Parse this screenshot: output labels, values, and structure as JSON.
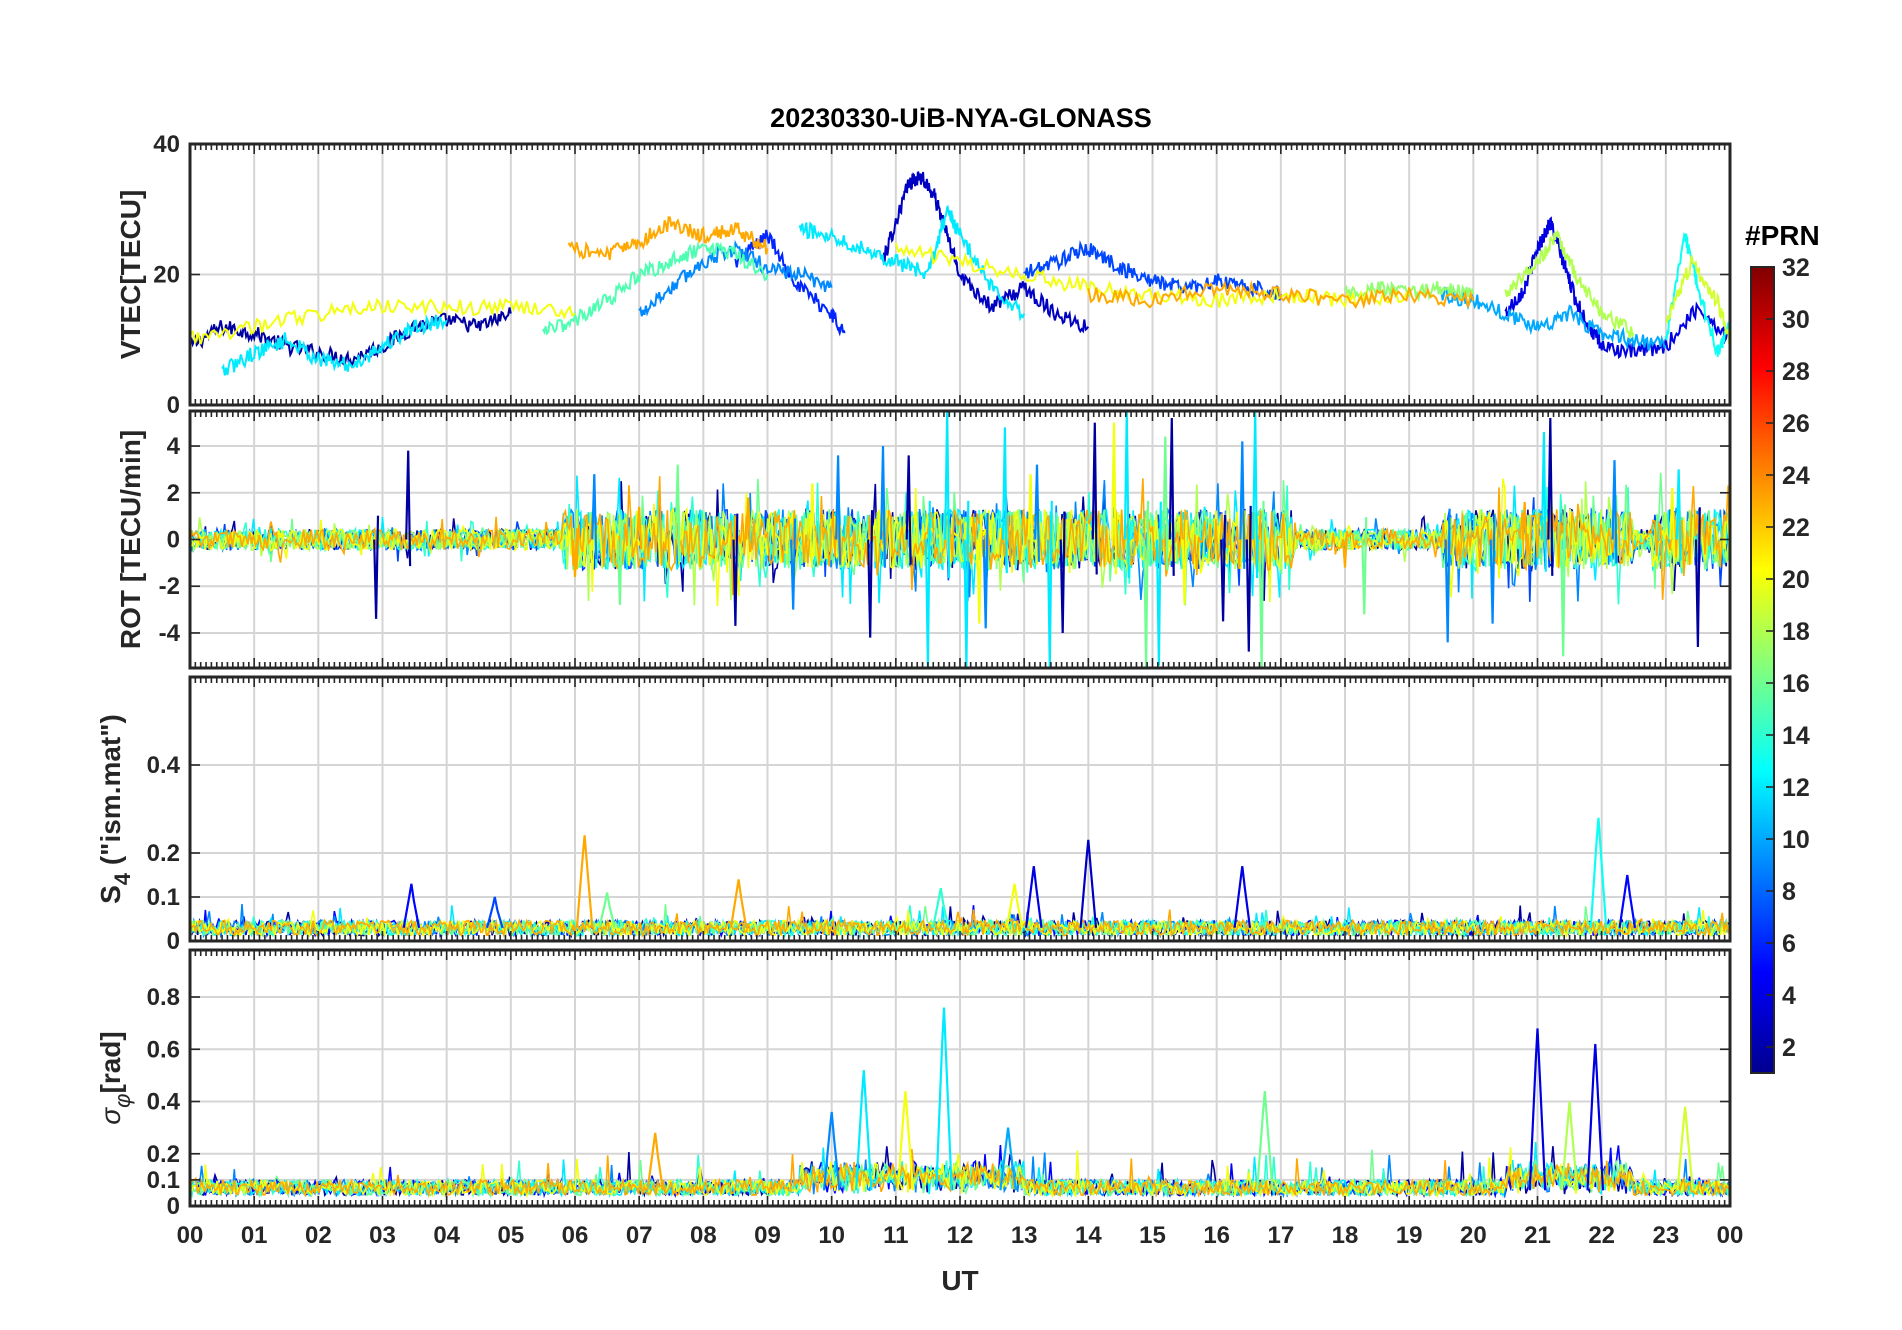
{
  "chart_data": {
    "type": "line",
    "title": "20230330-UiB-NYA-GLONASS",
    "xlabel": "UT",
    "x_ticks": [
      "00",
      "01",
      "02",
      "03",
      "04",
      "05",
      "06",
      "07",
      "08",
      "09",
      "10",
      "11",
      "12",
      "13",
      "14",
      "15",
      "16",
      "17",
      "18",
      "19",
      "20",
      "21",
      "22",
      "23",
      "00"
    ],
    "xlim_hours": [
      0,
      24
    ],
    "grid": true,
    "colorbar": {
      "title": "#PRN",
      "range": [
        1,
        32
      ],
      "ticks": [
        "2",
        "4",
        "6",
        "8",
        "10",
        "12",
        "14",
        "16",
        "18",
        "20",
        "22",
        "24",
        "26",
        "28",
        "30",
        "32"
      ],
      "colormap": "jet",
      "placement": "right"
    },
    "panels": [
      {
        "id": "vtec",
        "ylabel": "VTEC[TECU]",
        "ylim": [
          0,
          40
        ],
        "y_ticks": [
          0,
          20,
          40
        ],
        "y_tick_labels": [
          "0",
          "20",
          "40"
        ],
        "series": [
          {
            "prn": 2,
            "x": [
              0,
              0.5,
              1,
              1.5,
              2,
              2.5,
              3,
              3.5,
              4,
              4.5,
              5
            ],
            "y": [
              9,
              12,
              11,
              9,
              8,
              7,
              9,
              12,
              13,
              12,
              14
            ]
          },
          {
            "prn": 3,
            "x": [
              10.8,
              11,
              11.2,
              11.4,
              11.6,
              11.8,
              12,
              12.5,
              13,
              13.5,
              14
            ],
            "y": [
              22,
              28,
              34,
              35,
              32,
              26,
              20,
              15,
              18,
              14,
              12
            ]
          },
          {
            "prn": 4,
            "x": [
              20.5,
              20.8,
              21,
              21.2,
              21.4,
              21.6,
              21.8,
              22,
              22.5,
              23,
              23.5,
              24
            ],
            "y": [
              14,
              18,
              24,
              28,
              22,
              16,
              12,
              9,
              8,
              9,
              15,
              10
            ]
          },
          {
            "prn": 6,
            "x": [
              8.5,
              9,
              9.5,
              10,
              10.2
            ],
            "y": [
              22,
              26,
              18,
              14,
              11
            ]
          },
          {
            "prn": 7,
            "x": [
              13,
              13.5,
              14,
              14.5,
              15,
              15.5,
              16,
              16.5,
              17
            ],
            "y": [
              20,
              22,
              24,
              21,
              19,
              18,
              19,
              18,
              17
            ]
          },
          {
            "prn": 9,
            "x": [
              7,
              7.5,
              8,
              8.5,
              9,
              9.5,
              10
            ],
            "y": [
              14,
              18,
              22,
              24,
              21,
              20,
              18
            ]
          },
          {
            "prn": 10,
            "x": [
              19.5,
              20,
              20.5,
              21,
              21.5,
              22,
              22.5,
              23
            ],
            "y": [
              17,
              16,
              14,
              12,
              14,
              11,
              10,
              9
            ]
          },
          {
            "prn": 12,
            "x": [
              9.5,
              10,
              10.5,
              11,
              11.5,
              11.8,
              12,
              12.5,
              13
            ],
            "y": [
              27,
              26,
              24,
              22,
              20,
              30,
              26,
              18,
              14
            ]
          },
          {
            "prn": 12,
            "x": [
              0.5,
              1,
              1.5,
              2,
              2.5,
              3,
              3.5,
              4
            ],
            "y": [
              5,
              8,
              10,
              7,
              6,
              9,
              12,
              13
            ]
          },
          {
            "prn": 13,
            "x": [
              23,
              23.3,
              23.5,
              23.8,
              24
            ],
            "y": [
              10,
              26,
              18,
              8,
              12
            ]
          },
          {
            "prn": 15,
            "x": [
              5.5,
              6,
              6.5,
              7,
              7.5,
              8,
              8.5,
              9
            ],
            "y": [
              11,
              13,
              16,
              20,
              22,
              24,
              23,
              20
            ]
          },
          {
            "prn": 17,
            "x": [
              18,
              18.5,
              19,
              19.5,
              20
            ],
            "y": [
              17,
              18,
              17,
              18,
              17
            ]
          },
          {
            "prn": 18,
            "x": [
              20.5,
              21,
              21.3,
              21.6,
              22,
              22.5
            ],
            "y": [
              17,
              22,
              26,
              20,
              14,
              11
            ]
          },
          {
            "prn": 19,
            "x": [
              23,
              23.4,
              23.8,
              24
            ],
            "y": [
              12,
              22,
              16,
              10
            ]
          },
          {
            "prn": 20,
            "x": [
              0,
              1,
              2,
              3,
              4,
              5,
              6
            ],
            "y": [
              10,
              12,
              14,
              15,
              15,
              15,
              14
            ]
          },
          {
            "prn": 20,
            "x": [
              11,
              12,
              13,
              14,
              15,
              16,
              17,
              18,
              19
            ],
            "y": [
              24,
              22,
              20,
              18,
              17,
              16,
              17,
              16,
              17
            ]
          },
          {
            "prn": 23,
            "x": [
              5.9,
              6.5,
              7,
              7.5,
              8,
              8.5,
              9
            ],
            "y": [
              24,
              23,
              25,
              28,
              26,
              27,
              24
            ]
          },
          {
            "prn": 23,
            "x": [
              14,
              15,
              16,
              17,
              18,
              19,
              20
            ],
            "y": [
              17,
              16,
              18,
              17,
              16,
              17,
              16
            ]
          }
        ]
      },
      {
        "id": "rot",
        "ylabel": "ROT [TECU/min]",
        "ylim": [
          -5.5,
          5.5
        ],
        "y_ticks": [
          -4,
          -2,
          0,
          2,
          4
        ],
        "y_tick_labels": [
          "-4",
          "-2",
          "0",
          "2",
          "4"
        ],
        "series": [
          {
            "prn": 2,
            "x": [
              2.9,
              3.4,
              8.5,
              10.6,
              11.2,
              13.6,
              14.1,
              15.3,
              16.1,
              16.5,
              21.2,
              23.5
            ],
            "y": [
              -3.4,
              3.8,
              -3.7,
              -4.2,
              3.6,
              -4.0,
              5.0,
              5.2,
              -3.5,
              -4.8,
              5.2,
              -4.6
            ]
          },
          {
            "prn": 9,
            "x": [
              6.3,
              9.4,
              10.1,
              10.8,
              12.4,
              13.2,
              16.4,
              19.6,
              20.3,
              22.2
            ],
            "y": [
              2.8,
              -3.0,
              3.6,
              4.0,
              -3.8,
              3.2,
              4.2,
              -4.4,
              -3.6,
              3.4
            ]
          },
          {
            "prn": 12,
            "x": [
              11.5,
              11.8,
              12.1,
              12.7,
              13.4,
              14.6,
              15.1,
              16.6,
              21.1,
              23.2
            ],
            "y": [
              -5.5,
              5.5,
              -5.5,
              4.8,
              -5.5,
              5.5,
              -5.4,
              5.5,
              4.6,
              3.0
            ]
          },
          {
            "prn": 16,
            "x": [
              6.7,
              7.6,
              14.9,
              15.2,
              16.7,
              18.3,
              21.4
            ],
            "y": [
              -2.8,
              3.2,
              -5.5,
              4.4,
              -5.5,
              -3.2,
              -5.0
            ]
          },
          {
            "prn": 20,
            "x": [
              9.7,
              12.3,
              13.1,
              14.4,
              15.5,
              23.1
            ],
            "y": [
              2.4,
              -3.6,
              2.8,
              5.0,
              -2.8,
              2.2
            ]
          },
          {
            "prn": 23,
            "x": [
              6.0,
              7.0,
              8.7,
              18.0,
              20.8
            ],
            "y": [
              -1.6,
              1.4,
              1.8,
              -1.2,
              1.6
            ]
          }
        ]
      },
      {
        "id": "s4",
        "ylabel": "S4 (\"ism.mat\")",
        "ylabel_main": "S",
        "ylabel_sub": "4",
        "ylabel_rest": " (\"ism.mat\")",
        "ylim": [
          0,
          0.6
        ],
        "y_ticks": [
          0,
          0.1,
          0.2,
          0.4
        ],
        "y_tick_labels": [
          "0",
          "0.1",
          "0.2",
          "0.4"
        ],
        "series": [
          {
            "prn": 23,
            "x": [
              6.15
            ],
            "y": [
              0.24
            ]
          },
          {
            "prn": 23,
            "x": [
              8.55
            ],
            "y": [
              0.14
            ]
          },
          {
            "prn": 3,
            "x": [
              14.0
            ],
            "y": [
              0.23
            ]
          },
          {
            "prn": 4,
            "x": [
              13.15
            ],
            "y": [
              0.17
            ]
          },
          {
            "prn": 4,
            "x": [
              16.4
            ],
            "y": [
              0.17
            ]
          },
          {
            "prn": 13,
            "x": [
              21.95
            ],
            "y": [
              0.28
            ]
          },
          {
            "prn": 5,
            "x": [
              22.4
            ],
            "y": [
              0.15
            ]
          },
          {
            "prn": 16,
            "x": [
              6.5
            ],
            "y": [
              0.11
            ]
          },
          {
            "prn": 7,
            "x": [
              4.75
            ],
            "y": [
              0.1
            ]
          },
          {
            "prn": 5,
            "x": [
              3.45
            ],
            "y": [
              0.13
            ]
          },
          {
            "prn": 20,
            "x": [
              12.85
            ],
            "y": [
              0.13
            ]
          },
          {
            "prn": 14,
            "x": [
              11.7
            ],
            "y": [
              0.12
            ]
          }
        ]
      },
      {
        "id": "sigma_phi",
        "ylabel": "σφ[rad]",
        "ylabel_main": "σ",
        "ylabel_sub": "φ",
        "ylabel_rest": "[rad]",
        "ylim": [
          0,
          0.98
        ],
        "y_ticks": [
          0,
          0.1,
          0.2,
          0.4,
          0.6,
          0.8
        ],
        "y_tick_labels": [
          "0",
          "0.1",
          "0.2",
          "0.4",
          "0.6",
          "0.8"
        ],
        "series": [
          {
            "prn": 12,
            "x": [
              11.75
            ],
            "y": [
              0.76
            ]
          },
          {
            "prn": 12,
            "x": [
              10.5
            ],
            "y": [
              0.52
            ]
          },
          {
            "prn": 4,
            "x": [
              21.0
            ],
            "y": [
              0.68
            ]
          },
          {
            "prn": 4,
            "x": [
              21.9
            ],
            "y": [
              0.62
            ]
          },
          {
            "prn": 20,
            "x": [
              11.15
            ],
            "y": [
              0.44
            ]
          },
          {
            "prn": 16,
            "x": [
              16.75
            ],
            "y": [
              0.44
            ]
          },
          {
            "prn": 9,
            "x": [
              10.0
            ],
            "y": [
              0.36
            ]
          },
          {
            "prn": 18,
            "x": [
              21.5
            ],
            "y": [
              0.4
            ]
          },
          {
            "prn": 19,
            "x": [
              23.3
            ],
            "y": [
              0.38
            ]
          },
          {
            "prn": 23,
            "x": [
              7.25
            ],
            "y": [
              0.28
            ]
          },
          {
            "prn": 10,
            "x": [
              12.75
            ],
            "y": [
              0.3
            ]
          }
        ]
      }
    ]
  }
}
